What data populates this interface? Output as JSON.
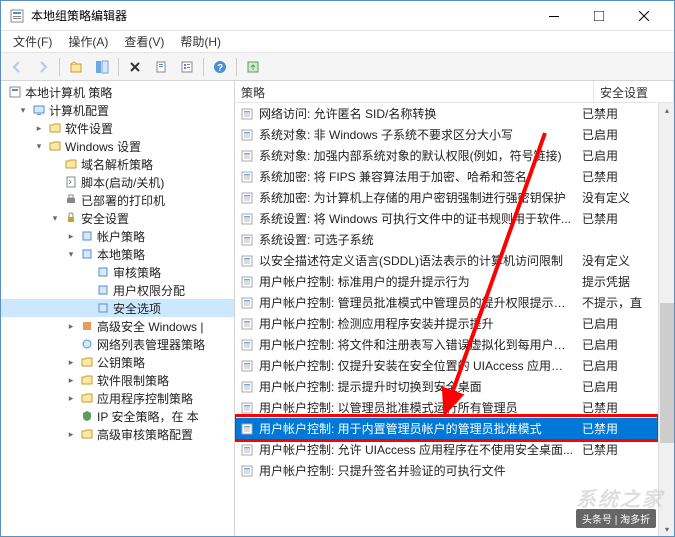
{
  "window": {
    "title": "本地组策略编辑器"
  },
  "menu": {
    "file": "文件(F)",
    "action": "操作(A)",
    "view": "查看(V)",
    "help": "帮助(H)"
  },
  "tree": {
    "root": "本地计算机 策略",
    "computer": "计算机配置",
    "software": "软件设置",
    "windows": "Windows 设置",
    "domain_policy": "域名解析策略",
    "scripts": "脚本(启动/关机)",
    "printers": "已部署的打印机",
    "security": "安全设置",
    "account_policy": "帐户策略",
    "local_policy": "本地策略",
    "audit_policy": "审核策略",
    "user_rights": "用户权限分配",
    "security_options": "安全选项",
    "advanced_windows": "高级安全 Windows |",
    "network_list": "网络列表管理器策略",
    "public_key": "公钥策略",
    "software_restrict": "软件限制策略",
    "app_control": "应用程序控制策略",
    "ip_security": "IP 安全策略，在 本",
    "advanced_audit": "高级审核策略配置"
  },
  "list": {
    "header_name": "策略",
    "header_setting": "安全设置",
    "rows": [
      {
        "name": "网络访问: 允许匿名 SID/名称转换",
        "setting": "已禁用",
        "selected": false
      },
      {
        "name": "系统对象: 非 Windows 子系统不要求区分大小写",
        "setting": "已启用",
        "selected": false
      },
      {
        "name": "系统对象: 加强内部系统对象的默认权限(例如，符号链接)",
        "setting": "已启用",
        "selected": false
      },
      {
        "name": "系统加密: 将 FIPS 兼容算法用于加密、哈希和签名",
        "setting": "已禁用",
        "selected": false
      },
      {
        "name": "系统加密: 为计算机上存储的用户密钥强制进行强密钥保护",
        "setting": "没有定义",
        "selected": false
      },
      {
        "name": "系统设置: 将 Windows 可执行文件中的证书规则用于软件...",
        "setting": "已禁用",
        "selected": false
      },
      {
        "name": "系统设置: 可选子系统",
        "setting": "",
        "selected": false
      },
      {
        "name": "以安全描述符定义语言(SDDL)语法表示的计算机访问限制",
        "setting": "没有定义",
        "selected": false
      },
      {
        "name": "用户帐户控制: 标准用户的提升提示行为",
        "setting": "提示凭据",
        "selected": false
      },
      {
        "name": "用户帐户控制: 管理员批准模式中管理员的提升权限提示的...",
        "setting": "不提示，直",
        "selected": false
      },
      {
        "name": "用户帐户控制: 检测应用程序安装并提示提升",
        "setting": "已启用",
        "selected": false
      },
      {
        "name": "用户帐户控制: 将文件和注册表写入错误虚拟化到每用户位置",
        "setting": "已启用",
        "selected": false
      },
      {
        "name": "用户帐户控制: 仅提升安装在安全位置的 UIAccess 应用程序",
        "setting": "已启用",
        "selected": false
      },
      {
        "name": "用户帐户控制: 提示提升时切换到安全桌面",
        "setting": "已启用",
        "selected": false
      },
      {
        "name": "用户帐户控制: 以管理员批准模式运行所有管理员",
        "setting": "已禁用",
        "selected": false
      },
      {
        "name": "用户帐户控制: 用于内置管理员帐户的管理员批准模式",
        "setting": "已禁用",
        "selected": true
      },
      {
        "name": "用户帐户控制: 允许 UIAccess 应用程序在不使用安全桌面...",
        "setting": "已禁用",
        "selected": false
      },
      {
        "name": "用户帐户控制: 只提升签名并验证的可执行文件",
        "setting": "",
        "selected": false
      }
    ]
  },
  "watermark": {
    "logo": "系统之家",
    "source": "头条号 | 淘多折"
  }
}
